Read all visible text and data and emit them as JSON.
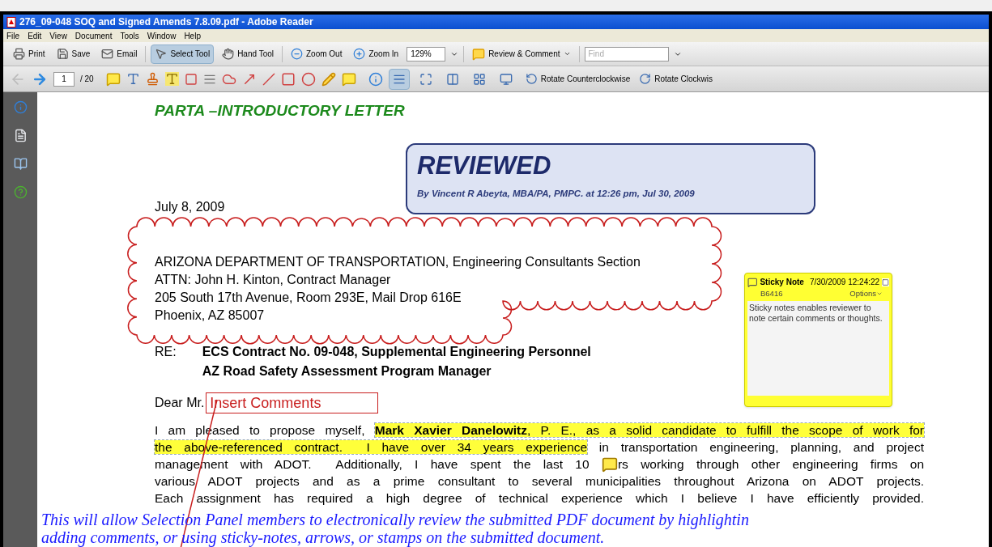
{
  "window": {
    "title": "276_09-048 SOQ and Signed Amends 7.8.09.pdf - Adobe Reader"
  },
  "menu": [
    "File",
    "Edit",
    "View",
    "Document",
    "Tools",
    "Window",
    "Help"
  ],
  "toolbar": [
    {
      "kind": "print",
      "label": "Print",
      "selected": false
    },
    {
      "kind": "save",
      "label": "Save",
      "selected": false
    },
    {
      "kind": "email",
      "label": "Email",
      "selected": false
    },
    {
      "kind": "select",
      "label": "Select Tool",
      "selected": true
    },
    {
      "kind": "hand",
      "label": "Hand Tool",
      "selected": false
    },
    {
      "kind": "zoom-out",
      "label": "Zoom Out",
      "selected": false
    },
    {
      "kind": "zoom-in",
      "label": "Zoom In",
      "selected": false
    }
  ],
  "zoom": {
    "value": "129%"
  },
  "review_button": {
    "label": "Review & Comment"
  },
  "find": {
    "placeholder": "Find"
  },
  "page_nav": {
    "page": "1",
    "total": "/ 20"
  },
  "view_tools": [
    {
      "kind": "fit-width",
      "selected": true
    },
    {
      "kind": "fit-page",
      "selected": false
    },
    {
      "kind": "two-page",
      "selected": false
    },
    {
      "kind": "grid",
      "selected": false
    },
    {
      "kind": "screen",
      "selected": false
    }
  ],
  "rotate_buttons": [
    "Rotate Counterclockwise",
    "Rotate Clockwis"
  ],
  "document": {
    "heading": "PARTA –INTRODUCTORY LETTER",
    "stamp": {
      "title": "REVIEWED",
      "byline": "By Vincent R Abeyta, MBA/PA, PMPC.  at 12:26 pm, Jul 30, 2009"
    },
    "date": "July 8, 2009",
    "address": [
      "ARIZONA DEPARTMENT OF TRANSPORTATION, Engineering Consultants Section",
      "ATTN: John H. Kinton, Contract Manager",
      "205 South 17th Avenue, Room 293E, Mail Drop 616E",
      "Phoenix, AZ  85007"
    ],
    "re_label": "RE:",
    "re_lines": [
      "ECS Contract No. 09-048, Supplemental Engineering Personnel",
      "AZ Road Safety Assessment Program Manager"
    ],
    "salutation": "Dear Mr.",
    "insert_comment": "Insert Comments",
    "paragraph": [
      [
        {
          "kind": "text",
          "text": "I am pleased to propose myself, ",
          "highlighted": false
        },
        {
          "kind": "text",
          "text": "**Mark Xavier Danelowitz**, P. E., as a solid candidate to fulfill the scope of work for",
          "highlighted": true
        }
      ],
      [
        {
          "kind": "text",
          "text": "the above-referenced contract.  I have over 34 years experience",
          "highlighted": true
        },
        {
          "kind": "text",
          "text": " in transportation engineering, planning, and project",
          "highlighted": false
        }
      ],
      [
        {
          "kind": "text",
          "text": "management with ADOT.  Additionally, I have spent the last 10 ",
          "highlighted": false
        },
        {
          "kind": "comment"
        },
        {
          "kind": "text",
          "text": "rs working through other engineering firms on",
          "highlighted": false
        }
      ],
      [
        {
          "kind": "text",
          "text": "various ADOT projects and as a prime consultant to several municipalities throughout Arizona on ADOT projects.",
          "highlighted": false
        }
      ],
      [
        {
          "kind": "text",
          "text": "Each assignment has required a high degree of technical experience which I believe I have efficiently provided.",
          "highlighted": false
        }
      ]
    ],
    "sticky_note": {
      "title": "Sticky Note",
      "timestamp": "7/30/2009 12:24:22",
      "author": "B6416",
      "options": "Options",
      "body": "Sticky notes enables reviewer to note certain comments or thoughts."
    }
  },
  "left_panel": [
    {
      "kind": "info"
    },
    {
      "kind": "pages"
    },
    {
      "kind": "bookmarks"
    },
    {
      "kind": "help"
    }
  ],
  "caption": [
    "This will allow Selection Panel members to electronically review the submitted PDF document by highlightin",
    "adding comments, or using sticky-notes, arrows, or stamps on the submitted document."
  ]
}
